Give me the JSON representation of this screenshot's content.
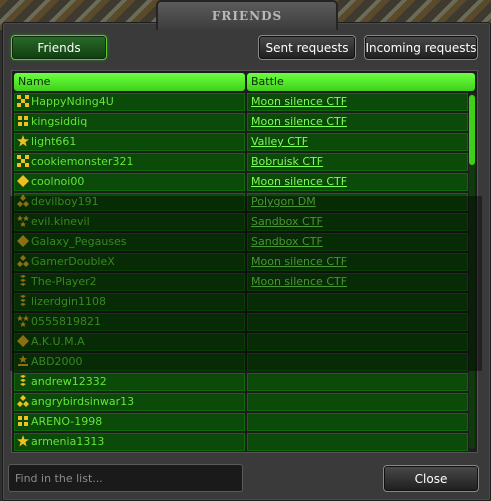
{
  "window": {
    "title": "FRIENDS"
  },
  "tabs": {
    "friends_label": "Friends",
    "sent_label": "Sent requests",
    "incoming_label": "Incoming requests"
  },
  "table": {
    "col_name": "Name",
    "col_battle": "Battle",
    "rows": [
      {
        "name": "HappyNding4U",
        "battle": "Moon silence CTF",
        "rank": "crosses-icon"
      },
      {
        "name": "kingsiddiq",
        "battle": "Moon silence CTF",
        "rank": "grid-icon"
      },
      {
        "name": "light661",
        "battle": "Valley CTF",
        "rank": "star-icon"
      },
      {
        "name": "cookiemonster321",
        "battle": "Bobruisk CTF",
        "rank": "crosses-icon"
      },
      {
        "name": "coolnoi00",
        "battle": "Moon silence CTF",
        "rank": "diamond-icon"
      },
      {
        "name": "devilboy191",
        "battle": "Polygon DM",
        "rank": "triple-chevron-icon"
      },
      {
        "name": "evil.kinevil",
        "battle": "Sandbox CTF",
        "rank": "double-star-icon"
      },
      {
        "name": "Galaxy_Pegauses",
        "battle": "Sandbox CTF",
        "rank": "diamond-icon"
      },
      {
        "name": "GamerDoubleX",
        "battle": "Moon silence CTF",
        "rank": "triple-chevron-icon"
      },
      {
        "name": "The-Player2",
        "battle": "Moon silence CTF",
        "rank": "chevron-icon"
      },
      {
        "name": "lizerdgin1108",
        "battle": "",
        "rank": "chevron-icon"
      },
      {
        "name": "0555819821",
        "battle": "",
        "rank": "double-star-icon"
      },
      {
        "name": "A.K.U.M.A",
        "battle": "",
        "rank": "diamond-icon"
      },
      {
        "name": "ABD2000",
        "battle": "",
        "rank": "laurel-icon"
      },
      {
        "name": "andrew12332",
        "battle": "",
        "rank": "chevron-icon"
      },
      {
        "name": "angrybirdsinwar13",
        "battle": "",
        "rank": "triple-chevron-icon"
      },
      {
        "name": "ARENO-1998",
        "battle": "",
        "rank": "grid-icon"
      },
      {
        "name": "armenia1313",
        "battle": "",
        "rank": "star-icon"
      }
    ]
  },
  "search": {
    "placeholder": "Find in the list..."
  },
  "close_label": "Close",
  "colors": {
    "accent_green": "#3fd019",
    "row_bg": "#0b4a09",
    "link_green": "#7bff55"
  }
}
